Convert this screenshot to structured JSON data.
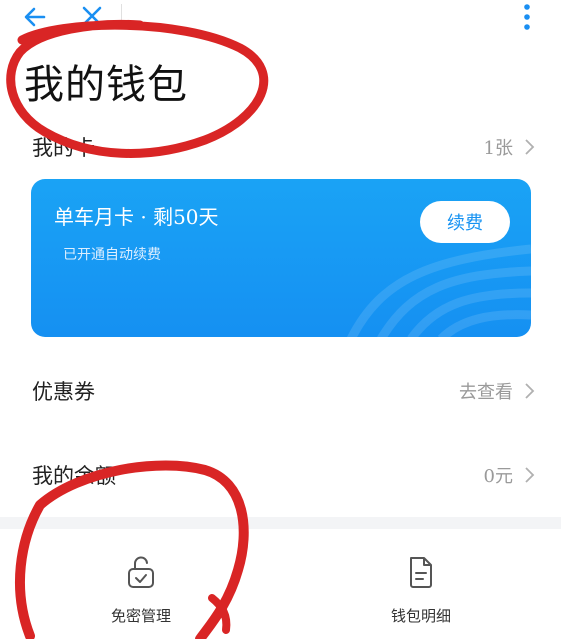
{
  "nav": {
    "back_icon": "arrow-left",
    "close_icon": "close-x",
    "more_icon": "vertical-dots",
    "accent_color": "#1a8ff2"
  },
  "page_title": "我的钱包",
  "my_cards": {
    "label": "我的卡",
    "value": "1张"
  },
  "card": {
    "title": "单车月卡 · 剩50天",
    "subtitle": "已开通自动续费",
    "renew_label": "续费",
    "color": "#1a9bf4"
  },
  "coupons": {
    "label": "优惠券",
    "value": "去查看"
  },
  "balance": {
    "label": "我的余额",
    "value": "0元"
  },
  "tools": [
    {
      "label": "免密管理",
      "icon": "unlock-check"
    },
    {
      "label": "钱包明细",
      "icon": "document-list"
    }
  ],
  "annotation_color": "#d92525"
}
